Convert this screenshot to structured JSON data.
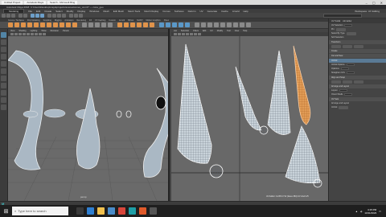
{
  "browser": {
    "tabs": [
      "Untitled Project",
      "Autodesk Maya",
      "Search - Microsoft Bing"
    ]
  },
  "titlebar": {
    "title": "Autodesk Maya 2018: C:\\Users\\Desktop\\maya\\projects\\scenes\\cones_uv.mb*  ---  cone_geo"
  },
  "menubar": {
    "items": [
      "File",
      "Edit",
      "Create",
      "Select",
      "Modify",
      "Display",
      "Windows",
      "Mesh",
      "Edit Mesh",
      "Mesh Tools",
      "Mesh Display",
      "Curves",
      "Surfaces",
      "Deform",
      "UV",
      "Generate",
      "Cache",
      "Arnold",
      "Help"
    ],
    "mode": "Modeling",
    "workspace": "Workspace: UV Editing"
  },
  "shelf": {
    "tabs": [
      "Curves / Surfaces",
      "Poly Modeling",
      "Sculpting",
      "Rigging",
      "Animation",
      "Rendering",
      "FX",
      "FX Caching",
      "Custom",
      "Arnold",
      "Bifrost",
      "MASH",
      "Motion Graphics",
      "XGen"
    ]
  },
  "left_panel": {
    "menu": [
      "View",
      "Shading",
      "Lighting",
      "Show",
      "Renderer",
      "Panels"
    ],
    "camera_label": "persp"
  },
  "right_panel": {
    "menu": [
      "List",
      "Selection",
      "Filters",
      "Edit",
      "UV",
      "Modify",
      "Tool",
      "View",
      "Help"
    ],
    "uv_readout": "UV Editor:  0.238   0.712     (faces 384)   UV shell 1/5"
  },
  "attribute_editor": {
    "header": [
      "UV Toolkit",
      "Attr Editor"
    ],
    "rows": [
      {
        "label": "UV Selection"
      },
      {
        "label": "Pin"
      },
      {
        "label": "Select By Type"
      },
      {
        "label": "Soft Selection"
      },
      {
        "label": "Transform"
      },
      {
        "label": "Create"
      },
      {
        "label": "Cut and Sew"
      },
      {
        "label": "Unfold"
      },
      {
        "label": "Align and Snap"
      },
      {
        "label": "Arrange and Layout"
      },
      {
        "label": "UV Sets"
      }
    ],
    "sections": [
      "Unfold",
      "Unfold Options",
      "Optimize",
      "Straighten UVs",
      "Layout",
      "Orient Shells",
      "Arrange and Layout"
    ]
  },
  "taskbar": {
    "search_placeholder": "Type here to search",
    "time": "4:15 PM",
    "date": "10/11/2023"
  },
  "colors": {
    "uv_selected": "#e08a38",
    "mesh_light": "#aab8c4",
    "grid_ref": "#2a2a2a",
    "maya_teal": "#3fc0c5"
  }
}
